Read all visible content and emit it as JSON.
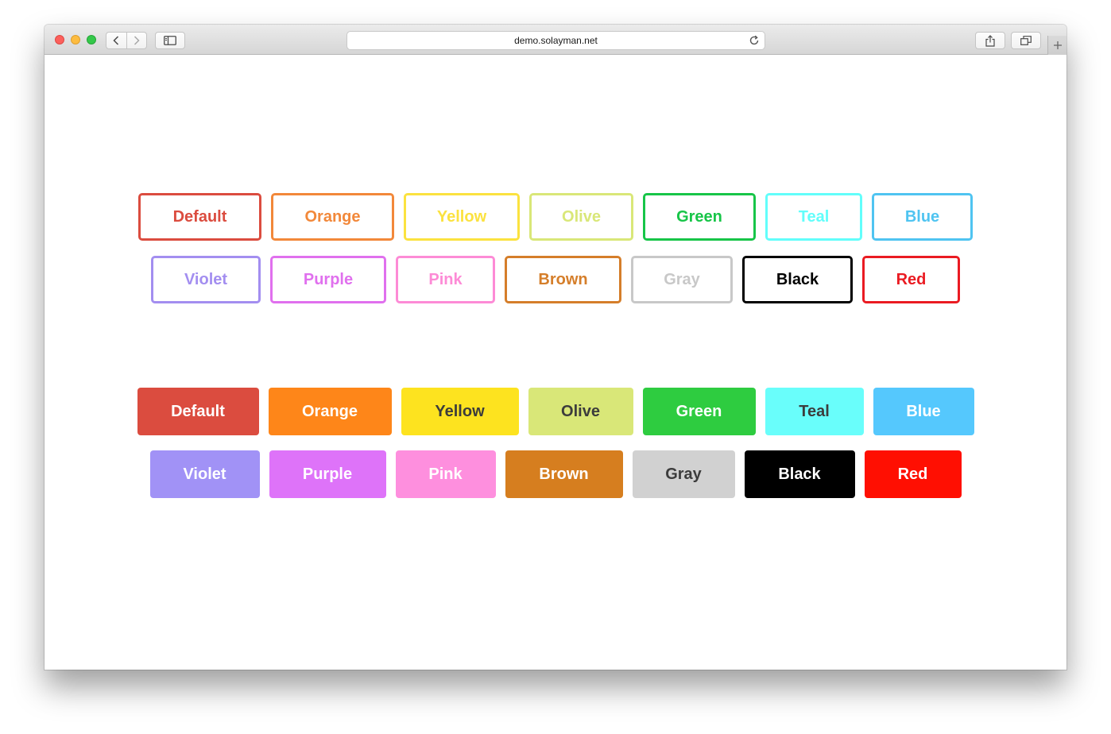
{
  "browser": {
    "url": "demo.solayman.net"
  },
  "outline_buttons": [
    [
      {
        "label": "Default",
        "color": "#db4c3f",
        "width": 155
      },
      {
        "label": "Orange",
        "color": "#f2883a",
        "width": 155
      },
      {
        "label": "Yellow",
        "color": "#fbe23f",
        "width": 146
      },
      {
        "label": "Olive",
        "color": "#d9e778",
        "width": 131
      },
      {
        "label": "Green",
        "color": "#17c548",
        "width": 142
      },
      {
        "label": "Teal",
        "color": "#62fefb",
        "width": 122
      },
      {
        "label": "Blue",
        "color": "#4fc4f1",
        "width": 127
      }
    ],
    [
      {
        "label": "Violet",
        "color": "#a38ef0",
        "width": 138
      },
      {
        "label": "Purple",
        "color": "#e070ee",
        "width": 146
      },
      {
        "label": "Pink",
        "color": "#fd8bd6",
        "width": 125
      },
      {
        "label": "Brown",
        "color": "#d57e2a",
        "width": 147
      },
      {
        "label": "Gray",
        "color": "#c8c8c8",
        "width": 128
      },
      {
        "label": "Black",
        "color": "#000000",
        "width": 139
      },
      {
        "label": "Red",
        "color": "#ea1b22",
        "width": 123
      }
    ]
  ],
  "filled_buttons": [
    [
      {
        "label": "Default",
        "bg": "#db4c3f",
        "fg": "#ffffff",
        "width": 153
      },
      {
        "label": "Orange",
        "bg": "#fe8619",
        "fg": "#ffffff",
        "width": 155
      },
      {
        "label": "Yellow",
        "bg": "#fde31f",
        "fg": "#3c3c3c",
        "width": 148
      },
      {
        "label": "Olive",
        "bg": "#d9e778",
        "fg": "#3c3c3c",
        "width": 132
      },
      {
        "label": "Green",
        "bg": "#2ecc40",
        "fg": "#ffffff",
        "width": 142
      },
      {
        "label": "Teal",
        "bg": "#69fefb",
        "fg": "#3c3c3c",
        "width": 124
      },
      {
        "label": "Blue",
        "bg": "#55c8fd",
        "fg": "#ffffff",
        "width": 127
      }
    ],
    [
      {
        "label": "Violet",
        "bg": "#a192f6",
        "fg": "#ffffff",
        "width": 138
      },
      {
        "label": "Purple",
        "bg": "#de73f9",
        "fg": "#ffffff",
        "width": 147
      },
      {
        "label": "Pink",
        "bg": "#fe8fde",
        "fg": "#ffffff",
        "width": 126
      },
      {
        "label": "Brown",
        "bg": "#d67e1f",
        "fg": "#ffffff",
        "width": 148
      },
      {
        "label": "Gray",
        "bg": "#d1d1d1",
        "fg": "#3c3c3c",
        "width": 129
      },
      {
        "label": "Black",
        "bg": "#000000",
        "fg": "#ffffff",
        "width": 139
      },
      {
        "label": "Red",
        "bg": "#ff0f02",
        "fg": "#ffffff",
        "width": 122
      }
    ]
  ]
}
